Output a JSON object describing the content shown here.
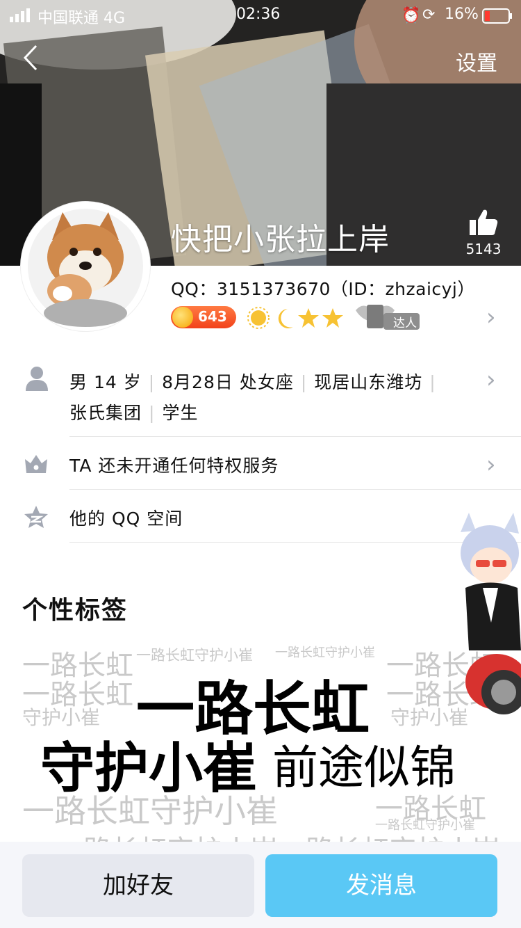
{
  "status_bar": {
    "carrier": "中国联通 4G",
    "time": "02:36",
    "battery": "16%"
  },
  "nav": {
    "back_icon": "chevron-left-icon",
    "settings_label": "设置"
  },
  "profile": {
    "nickname": "快把小张拉上岸",
    "likes": "5143",
    "qq_line": "QQ：3151373670（ID：zhzaicyj）",
    "coin_level": "643",
    "vip_badge": "达人"
  },
  "info": {
    "gender_age": "男 14 岁",
    "birthday_sign": "8月28日 处女座",
    "location": "现居山东潍坊",
    "company": "张氏集团",
    "occupation": "学生",
    "privilege": "TA 还未开通任何特权服务",
    "qzone": "他的 QQ 空间"
  },
  "tags": {
    "title": "个性标签",
    "line1": "一路长虹",
    "line2": "守护小崔",
    "line2b": "前途似锦",
    "faint_a": "一路长虹",
    "faint_b": "一路长虹守护小崔",
    "faint_c": "守护小崔",
    "faint_d": "一路长虹守护小崔",
    "faint_e": "一路长虹",
    "faint_f": "一路长虹守护小崔一路长虹守护小崔"
  },
  "actions": {
    "add_friend": "加好友",
    "send_message": "发消息"
  },
  "colors": {
    "accent": "#5ac8f5",
    "coin": "#f2421b",
    "secondary_button": "#e6e8ef"
  }
}
